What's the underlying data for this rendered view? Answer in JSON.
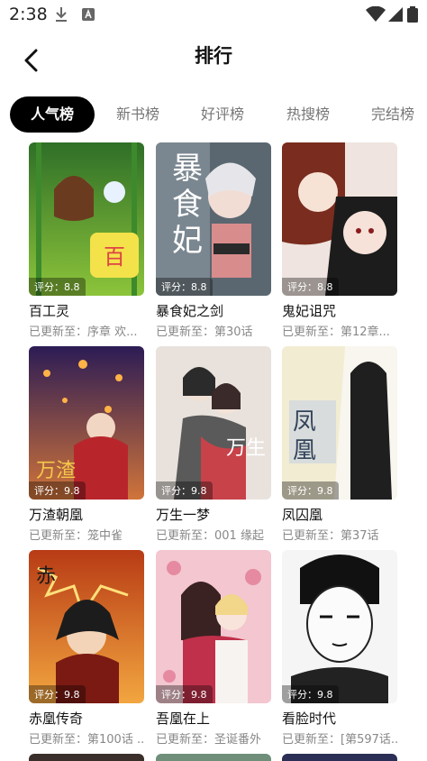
{
  "status_bar": {
    "time": "2:38"
  },
  "header": {
    "title": "排行"
  },
  "tabs": [
    {
      "label": "人气榜",
      "active": true
    },
    {
      "label": "新书榜",
      "active": false
    },
    {
      "label": "好评榜",
      "active": false
    },
    {
      "label": "热搜榜",
      "active": false
    },
    {
      "label": "完结榜",
      "active": false
    }
  ],
  "comics": [
    {
      "title": "百工灵",
      "score": "评分：8.8",
      "update": "已更新至：序章 欢..."
    },
    {
      "title": "暴食妃之剑",
      "score": "评分：8.8",
      "update": "已更新至：第30话"
    },
    {
      "title": "鬼妃诅咒",
      "score": "评分：8.8",
      "update": "已更新至：第12章..."
    },
    {
      "title": "万渣朝凰",
      "score": "评分：9.8",
      "update": "已更新至：笼中雀"
    },
    {
      "title": "万生一梦",
      "score": "评分：9.8",
      "update": "已更新至：001 缘起"
    },
    {
      "title": "凤囚凰",
      "score": "评分：9.8",
      "update": "已更新至：第37话"
    },
    {
      "title": "赤凰传奇",
      "score": "评分：9.8",
      "update": "已更新至：第100话 ..."
    },
    {
      "title": "吾凰在上",
      "score": "评分：9.8",
      "update": "已更新至：圣诞番外"
    },
    {
      "title": "看脸时代",
      "score": "评分：9.8",
      "update": "已更新至：[第597话..."
    }
  ]
}
